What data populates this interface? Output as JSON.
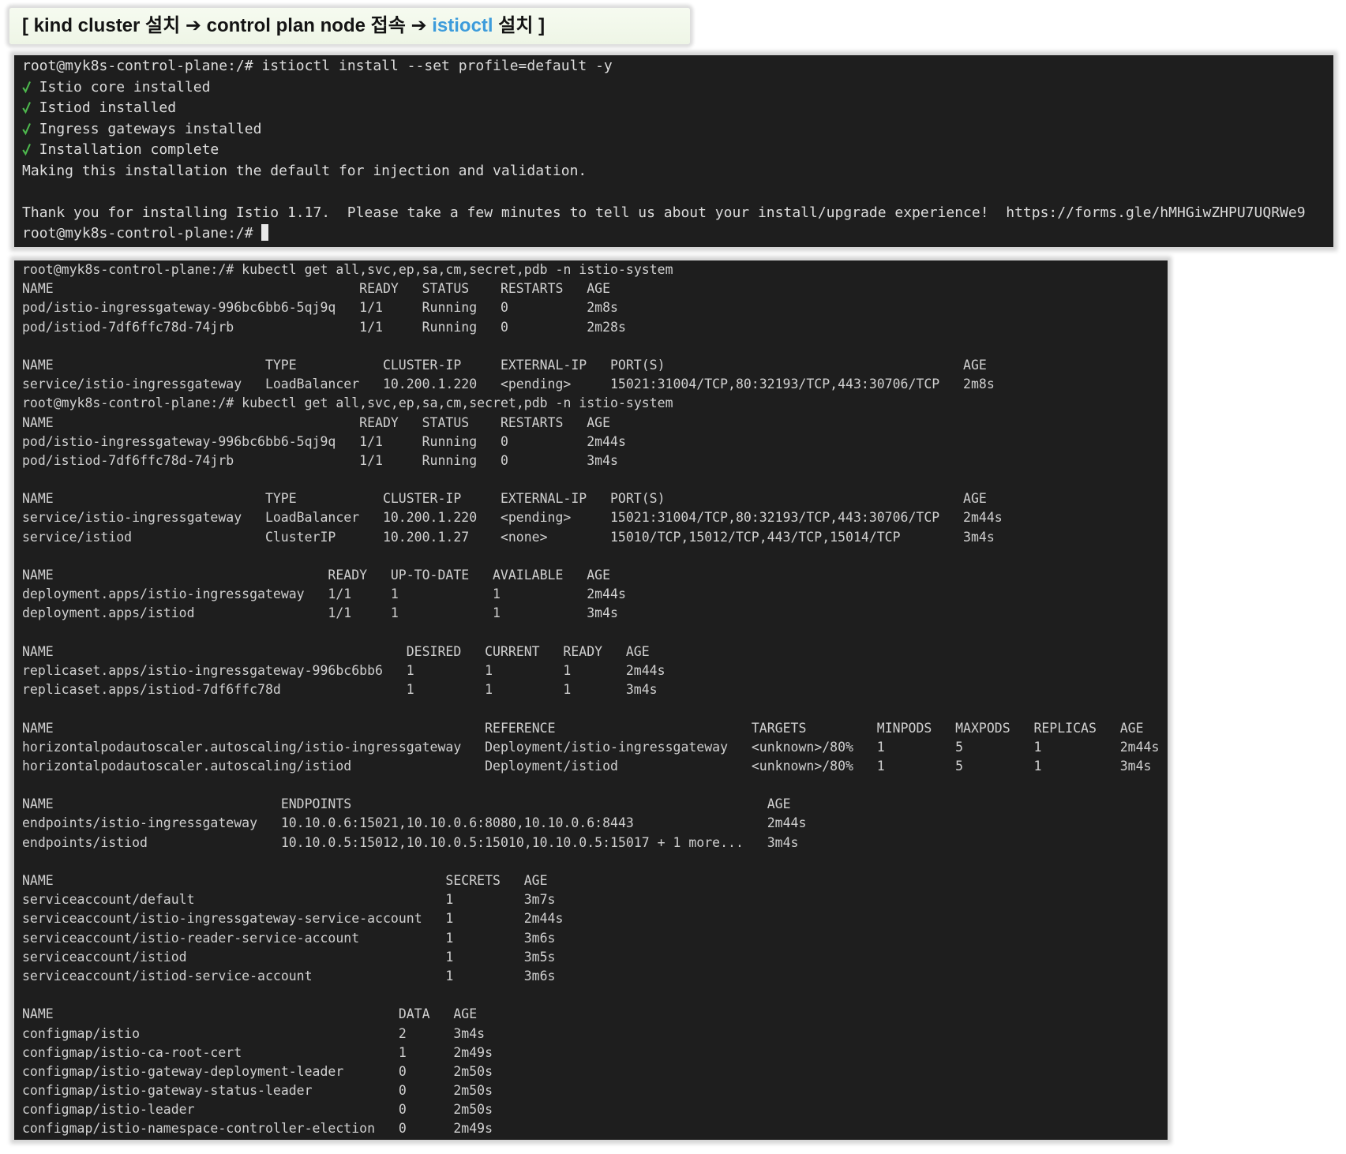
{
  "colors": {
    "terminal_background": "#1e1e1e",
    "terminal_text": "#d4d4d4",
    "check": "#4db84d",
    "highlight": "#3d9cdb",
    "banner_background": "#eef5e6"
  },
  "banner": {
    "prefix": "[ kind cluster 설치 ➔ control plan node 접속 ➔",
    "highlight": "istioctl",
    "suffix": "설치 ]"
  },
  "install_terminal": {
    "prompt": "root@myk8s-control-plane:/#",
    "command": "istioctl install --set profile=default -y",
    "check_icon": "check-icon",
    "checks": [
      "Istio core installed",
      "Istiod installed",
      "Ingress gateways installed",
      "Installation complete"
    ],
    "message": "Making this installation the default for injection and validation.",
    "thanks": "Thank you for installing Istio 1.17.  Please take a few minutes to tell us about your install/upgrade experience!  https://forms.gle/hMHGiwZHPU7UQRWe9",
    "final_prompt": "root@myk8s-control-plane:/#"
  },
  "kubectl_terminal": {
    "sessions": [
      {
        "prompt": "root@myk8s-control-plane:/#",
        "command": "kubectl get all,svc,ep,sa,cm,secret,pdb -n istio-system",
        "tables": [
          {
            "headers": [
              "NAME",
              "READY",
              "STATUS",
              "RESTARTS",
              "AGE"
            ],
            "rows": [
              [
                "pod/istio-ingressgateway-996bc6bb6-5qj9q",
                "1/1",
                "Running",
                "0",
                "2m8s"
              ],
              [
                "pod/istiod-7df6ffc78d-74jrb",
                "1/1",
                "Running",
                "0",
                "2m28s"
              ]
            ]
          },
          {
            "headers": [
              "NAME",
              "TYPE",
              "CLUSTER-IP",
              "EXTERNAL-IP",
              "PORT(S)",
              "AGE"
            ],
            "rows": [
              [
                "service/istio-ingressgateway",
                "LoadBalancer",
                "10.200.1.220",
                "<pending>",
                "15021:31004/TCP,80:32193/TCP,443:30706/TCP",
                "2m8s"
              ]
            ]
          }
        ]
      },
      {
        "prompt": "root@myk8s-control-plane:/#",
        "command": "kubectl get all,svc,ep,sa,cm,secret,pdb -n istio-system",
        "tables": [
          {
            "headers": [
              "NAME",
              "READY",
              "STATUS",
              "RESTARTS",
              "AGE"
            ],
            "rows": [
              [
                "pod/istio-ingressgateway-996bc6bb6-5qj9q",
                "1/1",
                "Running",
                "0",
                "2m44s"
              ],
              [
                "pod/istiod-7df6ffc78d-74jrb",
                "1/1",
                "Running",
                "0",
                "3m4s"
              ]
            ]
          },
          {
            "headers": [
              "NAME",
              "TYPE",
              "CLUSTER-IP",
              "EXTERNAL-IP",
              "PORT(S)",
              "AGE"
            ],
            "rows": [
              [
                "service/istio-ingressgateway",
                "LoadBalancer",
                "10.200.1.220",
                "<pending>",
                "15021:31004/TCP,80:32193/TCP,443:30706/TCP",
                "2m44s"
              ],
              [
                "service/istiod",
                "ClusterIP",
                "10.200.1.27",
                "<none>",
                "15010/TCP,15012/TCP,443/TCP,15014/TCP",
                "3m4s"
              ]
            ]
          },
          {
            "headers": [
              "NAME",
              "READY",
              "UP-TO-DATE",
              "AVAILABLE",
              "AGE"
            ],
            "rows": [
              [
                "deployment.apps/istio-ingressgateway",
                "1/1",
                "1",
                "1",
                "2m44s"
              ],
              [
                "deployment.apps/istiod",
                "1/1",
                "1",
                "1",
                "3m4s"
              ]
            ]
          },
          {
            "headers": [
              "NAME",
              "DESIRED",
              "CURRENT",
              "READY",
              "AGE"
            ],
            "rows": [
              [
                "replicaset.apps/istio-ingressgateway-996bc6bb6",
                "1",
                "1",
                "1",
                "2m44s"
              ],
              [
                "replicaset.apps/istiod-7df6ffc78d",
                "1",
                "1",
                "1",
                "3m4s"
              ]
            ]
          },
          {
            "headers": [
              "NAME",
              "REFERENCE",
              "TARGETS",
              "MINPODS",
              "MAXPODS",
              "REPLICAS",
              "AGE"
            ],
            "rows": [
              [
                "horizontalpodautoscaler.autoscaling/istio-ingressgateway",
                "Deployment/istio-ingressgateway",
                "<unknown>/80%",
                "1",
                "5",
                "1",
                "2m44s"
              ],
              [
                "horizontalpodautoscaler.autoscaling/istiod",
                "Deployment/istiod",
                "<unknown>/80%",
                "1",
                "5",
                "1",
                "3m4s"
              ]
            ]
          },
          {
            "headers": [
              "NAME",
              "ENDPOINTS",
              "AGE"
            ],
            "rows": [
              [
                "endpoints/istio-ingressgateway",
                "10.10.0.6:15021,10.10.0.6:8080,10.10.0.6:8443",
                "2m44s"
              ],
              [
                "endpoints/istiod",
                "10.10.0.5:15012,10.10.0.5:15010,10.10.0.5:15017 + 1 more...",
                "3m4s"
              ]
            ]
          },
          {
            "headers": [
              "NAME",
              "SECRETS",
              "AGE"
            ],
            "rows": [
              [
                "serviceaccount/default",
                "1",
                "3m7s"
              ],
              [
                "serviceaccount/istio-ingressgateway-service-account",
                "1",
                "2m44s"
              ],
              [
                "serviceaccount/istio-reader-service-account",
                "1",
                "3m6s"
              ],
              [
                "serviceaccount/istiod",
                "1",
                "3m5s"
              ],
              [
                "serviceaccount/istiod-service-account",
                "1",
                "3m6s"
              ]
            ]
          },
          {
            "headers": [
              "NAME",
              "DATA",
              "AGE"
            ],
            "rows": [
              [
                "configmap/istio",
                "2",
                "3m4s"
              ],
              [
                "configmap/istio-ca-root-cert",
                "1",
                "2m49s"
              ],
              [
                "configmap/istio-gateway-deployment-leader",
                "0",
                "2m50s"
              ],
              [
                "configmap/istio-gateway-status-leader",
                "0",
                "2m50s"
              ],
              [
                "configmap/istio-leader",
                "0",
                "2m50s"
              ],
              [
                "configmap/istio-namespace-controller-election",
                "0",
                "2m49s"
              ]
            ]
          }
        ]
      }
    ]
  }
}
